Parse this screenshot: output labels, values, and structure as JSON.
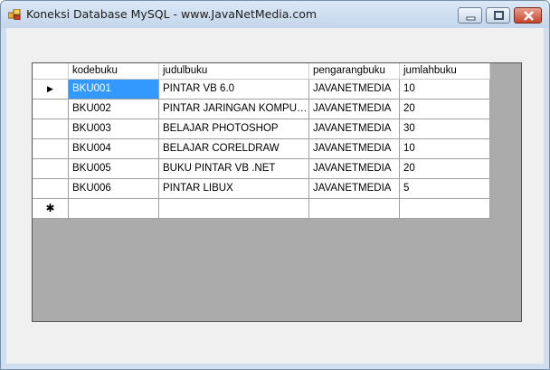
{
  "window": {
    "title": "Koneksi Database MySQL - www.JavaNetMedia.com"
  },
  "grid": {
    "columns": [
      "kodebuku",
      "judulbuku",
      "pengarangbuku",
      "jumlahbuku"
    ],
    "rows": [
      [
        "BKU001",
        "PINTAR VB 6.0",
        "JAVANETMEDIA",
        "10"
      ],
      [
        "BKU002",
        "PINTAR JARINGAN KOMPUT...",
        "JAVANETMEDIA",
        "20"
      ],
      [
        "BKU003",
        "BELAJAR PHOTOSHOP",
        "JAVANETMEDIA",
        "30"
      ],
      [
        "BKU004",
        "BELAJAR CORELDRAW",
        "JAVANETMEDIA",
        "10"
      ],
      [
        "BKU005",
        "BUKU PINTAR VB .NET",
        "JAVANETMEDIA",
        "20"
      ],
      [
        "BKU006",
        "PINTAR LIBUX",
        "JAVANETMEDIA",
        "5"
      ]
    ],
    "current_row_marker": "▶",
    "new_row_marker": "✱"
  },
  "colors": {
    "selection": "#3399ff",
    "grid_background": "#ababab",
    "form_background": "#f0f0f0"
  }
}
